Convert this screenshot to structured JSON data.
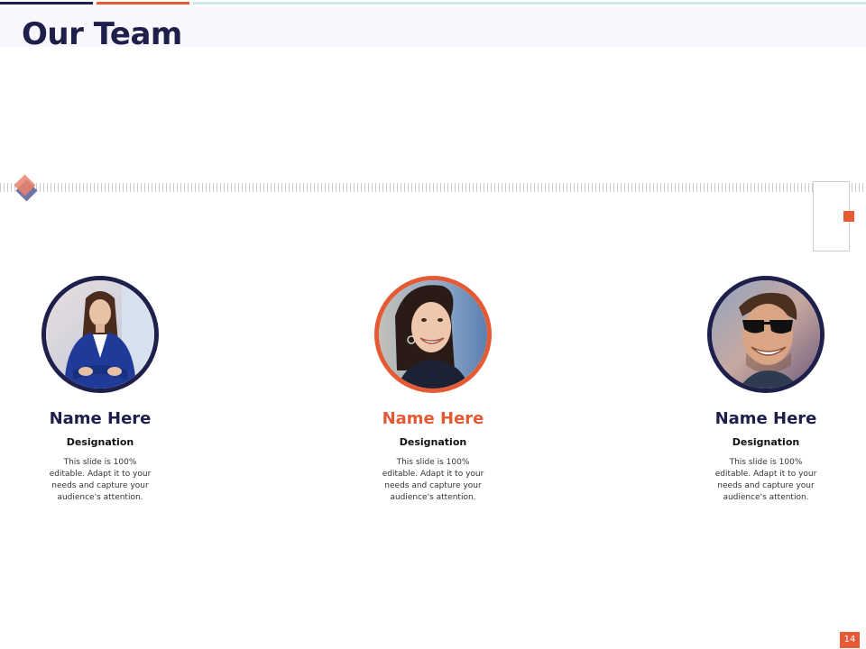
{
  "slide": {
    "title": "Our Team",
    "page_number": "14"
  },
  "colors": {
    "navy": "#1e1f4b",
    "orange": "#e35a35",
    "light_blue": "#cfe7ef"
  },
  "team": [
    {
      "name": "Name Here",
      "designation": "Designation",
      "description": "This slide is 100% editable. Adapt it to your needs and capture your audience's attention.",
      "photo": "woman-in-blue-blazer-photo"
    },
    {
      "name": "Name Here",
      "designation": "Designation",
      "description": "This slide is 100% editable. Adapt it to your needs and capture your audience's attention.",
      "photo": "smiling-woman-photo"
    },
    {
      "name": "Name Here",
      "designation": "Designation",
      "description": "This slide is 100% editable. Adapt it to your needs and capture your audience's attention.",
      "photo": "man-with-sunglasses-photo"
    }
  ]
}
